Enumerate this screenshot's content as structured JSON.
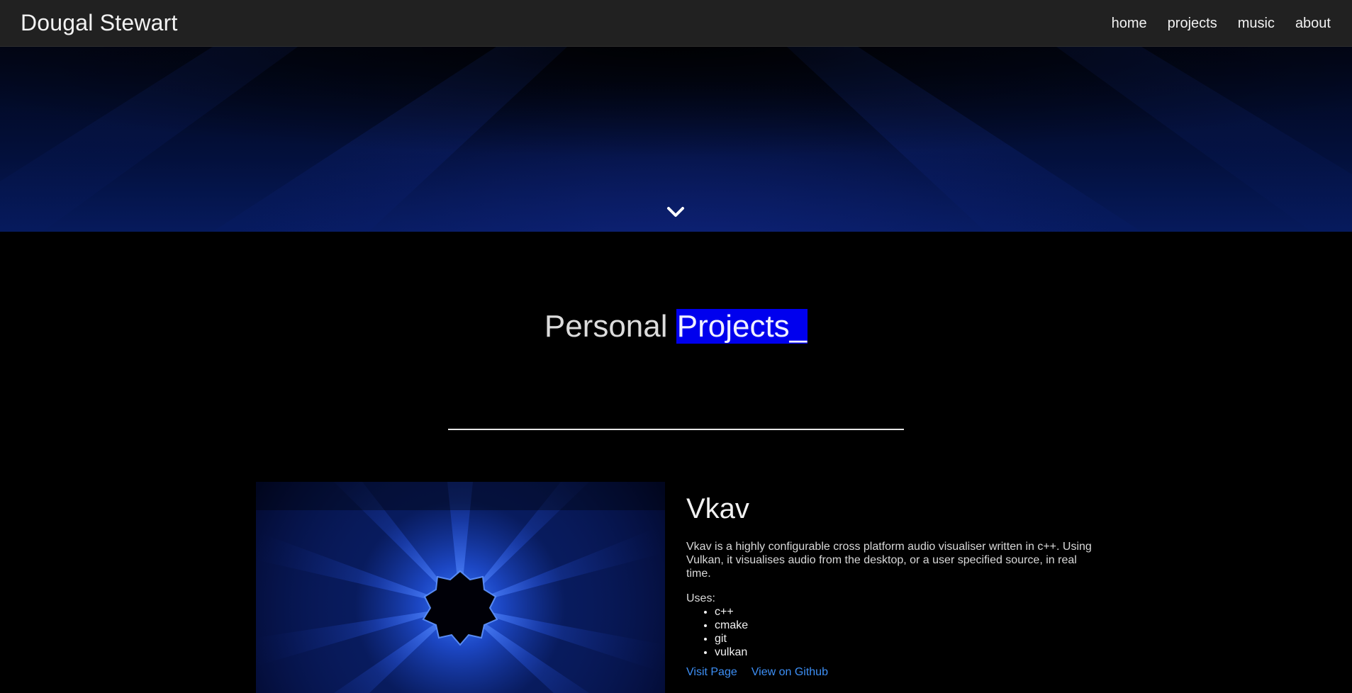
{
  "navbar": {
    "brand": "Dougal Stewart",
    "links": [
      "home",
      "projects",
      "music",
      "about"
    ]
  },
  "hero": {
    "icons": {
      "scroll_down": "chevron-down-icon"
    }
  },
  "section": {
    "title_plain": "Personal ",
    "title_highlight": "Projects_"
  },
  "projects": [
    {
      "title": "Vkav",
      "description": "Vkav is a highly configurable cross platform audio visualiser written in c++. Using Vulkan, it visualises audio from the desktop, or a user specified source, in real time.",
      "uses_label": "Uses:",
      "uses": [
        "c++",
        "cmake",
        "git",
        "vulkan"
      ],
      "links": {
        "visit": "Visit Page",
        "github": "View on Github"
      }
    }
  ],
  "colors": {
    "navbar_bg": "#212121",
    "highlight_bg": "#0000ee",
    "link": "#3d8ff5",
    "background": "#000000"
  }
}
